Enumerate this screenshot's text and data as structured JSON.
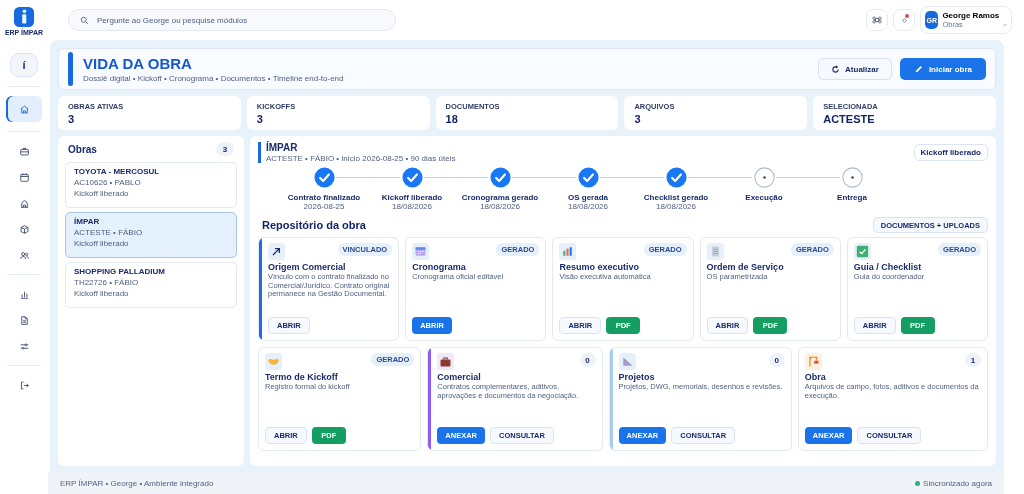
{
  "brand": {
    "name": "ERP ÍMPAR"
  },
  "sidebar": {
    "top_button": "í",
    "nav_groups": [
      [
        {
          "selected": true
        }
      ],
      [
        {
          "selected": false
        },
        {
          "selected": false
        },
        {
          "selected": false
        },
        {
          "selected": false
        },
        {
          "selected": false
        }
      ],
      [
        {
          "selected": false
        },
        {
          "selected": false
        },
        {
          "selected": false
        }
      ],
      [
        {
          "selected": false
        }
      ]
    ]
  },
  "search": {
    "placeholder": "Pergunte ao George ou pesquise módulos"
  },
  "topbar": {
    "notification": true,
    "user": {
      "initials": "GR",
      "name": "George Ramos",
      "role": "Obras"
    }
  },
  "header": {
    "title": "VIDA DA OBRA",
    "subtitle": "Dossiê digital • Kickoff • Cronograma • Documentos • Timeline end-to-end",
    "buttons": [
      {
        "kind": "secondary",
        "label": "Atualizar"
      },
      {
        "kind": "primary",
        "label": "Iniciar obra"
      }
    ]
  },
  "stats": [
    {
      "label": "OBRAS ATIVAS",
      "value": "3"
    },
    {
      "label": "KICKOFFS",
      "value": "3"
    },
    {
      "label": "DOCUMENTOS",
      "value": "18"
    },
    {
      "label": "ARQUIVOS",
      "value": "3"
    },
    {
      "label": "SELECIONADA",
      "value": "ACTESTE"
    }
  ],
  "obras": {
    "title": "Obras",
    "count": "3",
    "items": [
      {
        "name": "TOYOTA - MERCOSUL",
        "meta": "AC10626 • PABLO",
        "status": "Kickoff liberado",
        "selected": false
      },
      {
        "name": "ÍMPAR",
        "meta": "ACTESTE • FÁBIO",
        "status": "Kickoff liberado",
        "selected": true
      },
      {
        "name": "SHOPPING PALLADIUM",
        "meta": "TH22726 • FÁBIO",
        "status": "Kickoff liberado",
        "selected": false
      }
    ]
  },
  "detail": {
    "title": "ÍMPAR",
    "meta": "ACTESTE • FÁBIO • início 2026-08-25 • 90 dias úteis",
    "badge": "Kickoff liberado",
    "timeline": [
      {
        "label": "Contrato finalizado",
        "date": "2026-08-25",
        "done": true
      },
      {
        "label": "Kickoff liberado",
        "date": "18/08/2026",
        "done": true
      },
      {
        "label": "Cronograma gerado",
        "date": "18/08/2026",
        "done": true
      },
      {
        "label": "OS gerada",
        "date": "18/08/2026",
        "done": true
      },
      {
        "label": "Checklist gerado",
        "date": "18/08/2026",
        "done": true
      },
      {
        "label": "Execução",
        "done": false
      },
      {
        "label": "Entrega",
        "done": false
      }
    ],
    "repository": {
      "title": "Repositório da obra",
      "action": "DOCUMENTOS + UPLOADS",
      "rows": [
        [
          {
            "title": "Origem Comercial",
            "description": "Vínculo com o contrato finalizado no Comercial/Jurídico. Contrato original permanece na Gestão Documental.",
            "badge": "VINCULADO",
            "color": "#1d6fe0",
            "buttons": [
              {
                "kind": "secondary",
                "label": "ABRIR"
              }
            ]
          },
          {
            "title": "Cronograma",
            "description": "Cronograma oficial editável",
            "badge": "GERADO",
            "buttons": [
              {
                "kind": "primary",
                "label": "ABRIR"
              }
            ]
          },
          {
            "title": "Resumo executivo",
            "description": "Visão executiva automática",
            "badge": "GERADO",
            "buttons": [
              {
                "kind": "secondary",
                "label": "ABRIR"
              },
              {
                "kind": "pdf",
                "label": "PDF"
              }
            ]
          },
          {
            "title": "Ordem de Serviço",
            "description": "OS parametrizada",
            "badge": "GERADO",
            "buttons": [
              {
                "kind": "secondary",
                "label": "ABRIR"
              },
              {
                "kind": "pdf",
                "label": "PDF"
              }
            ]
          },
          {
            "title": "Guia / Checklist",
            "description": "Guia do coordenador",
            "badge": "GERADO",
            "buttons": [
              {
                "kind": "secondary",
                "label": "ABRIR"
              },
              {
                "kind": "pdf",
                "label": "PDF"
              }
            ]
          }
        ],
        [
          {
            "title": "Termo de Kickoff",
            "description": "Registro formal do kickoff",
            "badge": "GERADO",
            "buttons": [
              {
                "kind": "secondary",
                "label": "ABRIR"
              },
              {
                "kind": "pdf",
                "label": "PDF"
              }
            ]
          },
          {
            "title": "Comercial",
            "description": "Contratos complementares, aditivos, aprovações e documentos da negociação.",
            "count": "0",
            "color": "#8b5cf6",
            "buttons": [
              {
                "kind": "primary",
                "label": "ANEXAR"
              },
              {
                "kind": "secondary",
                "label": "CONSULTAR"
              }
            ]
          },
          {
            "title": "Projetos",
            "description": "Projetos, DWG, memoriais, desenhos e revisões.",
            "count": "0",
            "color": "#a9cdf0",
            "buttons": [
              {
                "kind": "primary",
                "label": "ANEXAR"
              },
              {
                "kind": "secondary",
                "label": "CONSULTAR"
              }
            ]
          },
          {
            "title": "Obra",
            "description": "Arquivos de campo, fotos, aditivos e documentos da execução.",
            "count": "1",
            "buttons": [
              {
                "kind": "primary",
                "label": "ANEXAR"
              },
              {
                "kind": "secondary",
                "label": "CONSULTAR"
              }
            ]
          }
        ]
      ]
    }
  },
  "footer": {
    "text": "ERP ÍMPAR • George • Ambiente integrado",
    "status": "Sincronizado agora"
  }
}
